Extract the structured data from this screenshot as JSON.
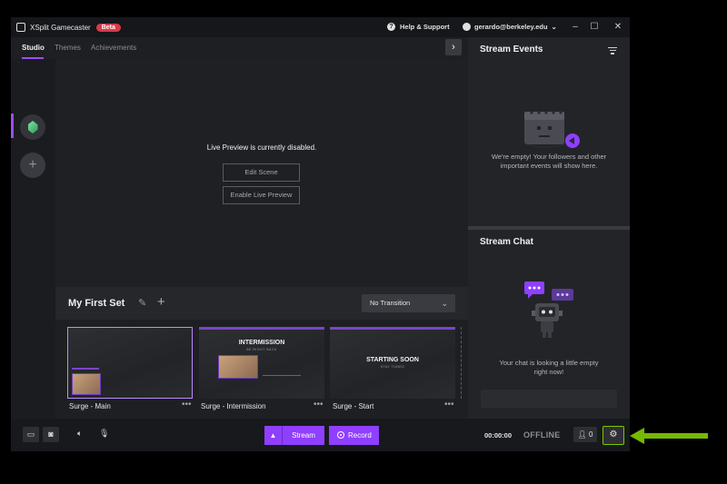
{
  "app": {
    "title": "XSplit Gamecaster",
    "badge": "Beta"
  },
  "header": {
    "help_label": "Help & Support",
    "user_label": "gerardo@berkeley.edu",
    "user_chevron": "⌄"
  },
  "window_controls": {
    "minimize": "–",
    "maximize": "☐",
    "close": "✕"
  },
  "tabs": [
    {
      "label": "Studio",
      "active": true
    },
    {
      "label": "Themes"
    },
    {
      "label": "Achievements"
    }
  ],
  "preview": {
    "message": "Live Preview is currently disabled.",
    "edit_scene_label": "Edit Scene",
    "enable_preview_label": "Enable Live Preview"
  },
  "scene_set": {
    "title": "My First Set",
    "transition": "No Transition"
  },
  "scenes": [
    {
      "label": "Surge - Main",
      "active": true
    },
    {
      "label": "Surge - Intermission",
      "overlay_title": "INTERMISSION",
      "overlay_sub": "BE RIGHT BACK"
    },
    {
      "label": "Surge - Start",
      "overlay_title": "STARTING SOON",
      "overlay_sub": "STAY TUNED"
    }
  ],
  "stream_events": {
    "title": "Stream Events",
    "empty_line1": "We're empty! Your followers and other",
    "empty_line2": "important events will show here."
  },
  "stream_chat": {
    "title": "Stream Chat",
    "empty_line1": "Your chat is looking a little empty",
    "empty_line2": "right now!"
  },
  "toolbar": {
    "stream_label": "Stream",
    "record_label": "Record",
    "timer": "00:00:00",
    "status": "OFFLINE",
    "viewer_count": "0"
  },
  "colors": {
    "accent": "#8f3fff",
    "highlight": "#7dc800",
    "background": "#1e1f22"
  },
  "icons": [
    "help-icon",
    "user-icon",
    "chevron-right-icon",
    "pencil-icon",
    "plus-icon",
    "filter-icon",
    "device-icon",
    "camera-icon",
    "volume-icon",
    "microphone-icon",
    "viewers-icon",
    "gear-icon",
    "arrow-left-icon"
  ]
}
